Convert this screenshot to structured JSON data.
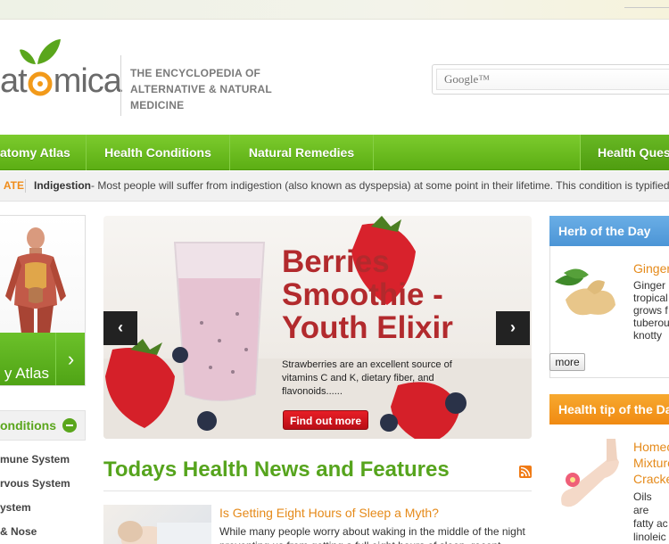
{
  "brand": {
    "logo_text_left": "at",
    "logo_text_right": "mica",
    "tagline": "THE ENCYCLOPEDIA OF ALTERNATIVE & NATURAL MEDICINE"
  },
  "search": {
    "placeholder": "Google™"
  },
  "nav": {
    "items": [
      "atomy Atlas",
      "Health Conditions",
      "Natural Remedies"
    ],
    "right_item": "Health Ques"
  },
  "ticker": {
    "label": "ATE",
    "title": "Indigestion",
    "text": " - Most people will suffer from indigestion (also known as dyspepsia) at some point in their lifetime. This condition is typified"
  },
  "sidebar": {
    "atlas_label": "y Atlas",
    "conditions_title": "onditions",
    "condition_items": [
      "mune System",
      "rvous System",
      "ystem",
      "& Nose"
    ]
  },
  "slider": {
    "title": "Berries Smoothie - Youth Elixir",
    "text": "Strawberries are an excellent source of vitamins C and K, dietary fiber, and flavonoids......",
    "button": "Find out more"
  },
  "news": {
    "section_title": "Todays Health News and Features",
    "items": [
      {
        "headline": "Is Getting Eight Hours of Sleep a Myth?",
        "text": "While many people worry about waking in the middle of the night preventing us from getting a full eight hours of sleep, recent"
      }
    ]
  },
  "herb": {
    "header": "Herb of the Day",
    "name": "Ginger",
    "description": "Ginger tropical grows f tuberou knotty a",
    "more_button": "more"
  },
  "tip": {
    "header": "Health tip of the Day",
    "title": "Homeo Mixture Cracke",
    "description": "Oils are fatty ac linoleic linolenic"
  },
  "colors": {
    "nav_green": "#5cae14",
    "accent_orange": "#e58a1a",
    "title_red": "#b22a2d",
    "herb_blue": "#4c95d6",
    "tip_orange": "#f08a12"
  }
}
